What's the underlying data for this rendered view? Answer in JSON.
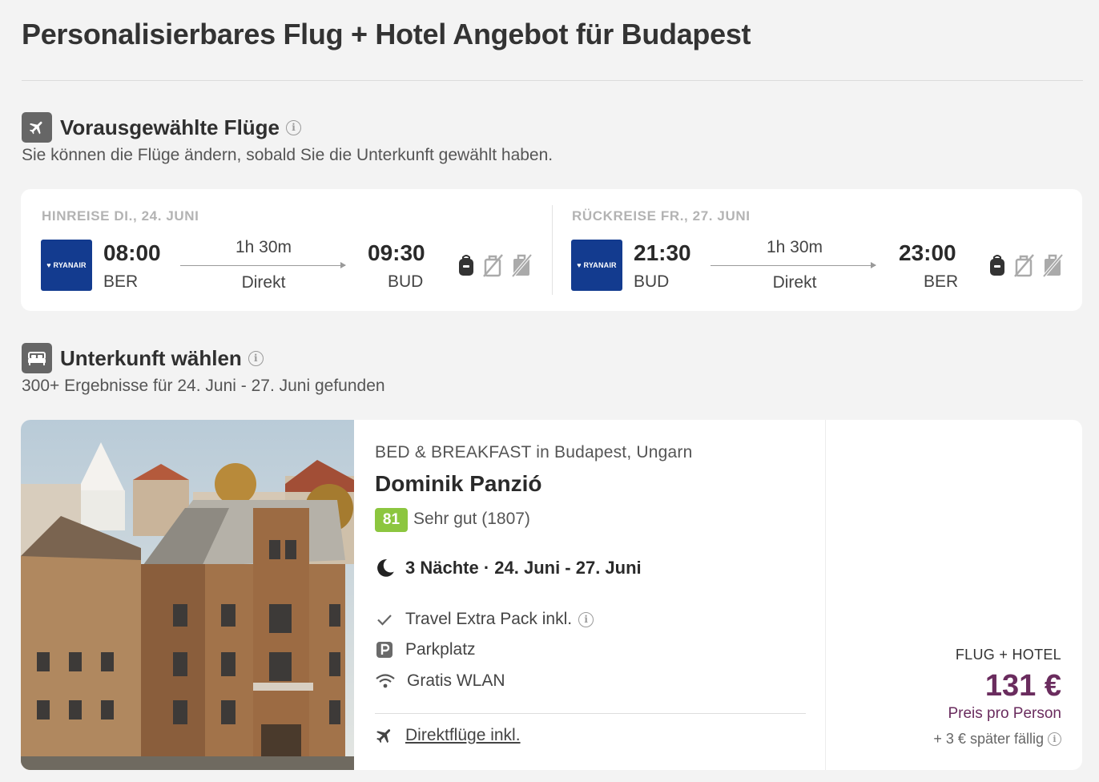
{
  "page": {
    "title": "Personalisierbares Flug + Hotel Angebot für Budapest"
  },
  "flights_section": {
    "title": "Vorausgewählte Flüge",
    "subtitle": "Sie können die Flüge ändern, sobald Sie die Unterkunft gewählt haben.",
    "icon": "plane-icon",
    "outbound": {
      "label": "HINREISE DI., 24. JUNI",
      "airline": "RYANAIR",
      "dep_time": "08:00",
      "dep_code": "BER",
      "duration": "1h 30m",
      "stops": "Direkt",
      "arr_time": "09:30",
      "arr_code": "BUD"
    },
    "return": {
      "label": "RÜCKREISE FR., 27. JUNI",
      "airline": "RYANAIR",
      "dep_time": "21:30",
      "dep_code": "BUD",
      "duration": "1h 30m",
      "stops": "Direkt",
      "arr_time": "23:00",
      "arr_code": "BER"
    }
  },
  "accommodation_section": {
    "title": "Unterkunft wählen",
    "subtitle": "300+ Ergebnisse für 24. Juni - 27. Juni gefunden",
    "icon": "bed-icon"
  },
  "hotel": {
    "type": "BED & BREAKFAST in Budapest, Ungarn",
    "name": "Dominik Panzió",
    "rating_score": "81",
    "rating_text": "Sehr gut (1807)",
    "stay": "3 Nächte · 24. Juni - 27. Juni",
    "amenities": [
      {
        "icon": "check-icon",
        "label": "Travel Extra Pack inkl."
      },
      {
        "icon": "parking-icon",
        "label": "Parkplatz"
      },
      {
        "icon": "wifi-icon",
        "label": "Gratis WLAN"
      }
    ],
    "direct_flights": "Direktflüge inkl."
  },
  "price": {
    "label": "FLUG + HOTEL",
    "value": "131 €",
    "per_person": "Preis pro Person",
    "later": "+ 3 € später fällig"
  },
  "colors": {
    "background": "#f3f3f3",
    "airline_blue": "#133b8f",
    "rating_green": "#8cc63f",
    "price_purple": "#6a2c5e"
  }
}
